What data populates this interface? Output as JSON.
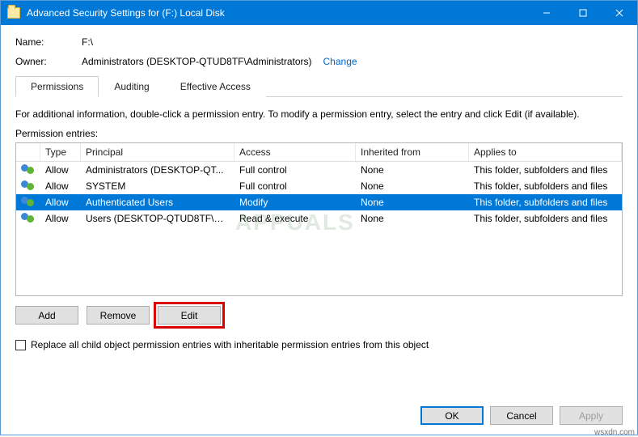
{
  "titlebar": {
    "text": "Advanced Security Settings for (F:) Local Disk"
  },
  "name_label": "Name:",
  "name_value": "F:\\",
  "owner_label": "Owner:",
  "owner_value": "Administrators (DESKTOP-QTUD8TF\\Administrators)",
  "change_link": "Change",
  "tabs": {
    "permissions": "Permissions",
    "auditing": "Auditing",
    "effective": "Effective Access"
  },
  "description": "For additional information, double-click a permission entry. To modify a permission entry, select the entry and click Edit (if available).",
  "entries_label": "Permission entries:",
  "columns": {
    "type": "Type",
    "principal": "Principal",
    "access": "Access",
    "inherited": "Inherited from",
    "applies": "Applies to"
  },
  "rows": [
    {
      "type": "Allow",
      "principal": "Administrators (DESKTOP-QT...",
      "access": "Full control",
      "inherited": "None",
      "applies": "This folder, subfolders and files",
      "selected": false
    },
    {
      "type": "Allow",
      "principal": "SYSTEM",
      "access": "Full control",
      "inherited": "None",
      "applies": "This folder, subfolders and files",
      "selected": false
    },
    {
      "type": "Allow",
      "principal": "Authenticated Users",
      "access": "Modify",
      "inherited": "None",
      "applies": "This folder, subfolders and files",
      "selected": true
    },
    {
      "type": "Allow",
      "principal": "Users (DESKTOP-QTUD8TF\\Us...",
      "access": "Read & execute",
      "inherited": "None",
      "applies": "This folder, subfolders and files",
      "selected": false
    }
  ],
  "buttons": {
    "add": "Add",
    "remove": "Remove",
    "edit": "Edit"
  },
  "replace_checkbox": "Replace all child object permission entries with inheritable permission entries from this object",
  "footer": {
    "ok": "OK",
    "cancel": "Cancel",
    "apply": "Apply"
  },
  "watermark": "APPUALS",
  "source_mark": "wsxdn.com"
}
